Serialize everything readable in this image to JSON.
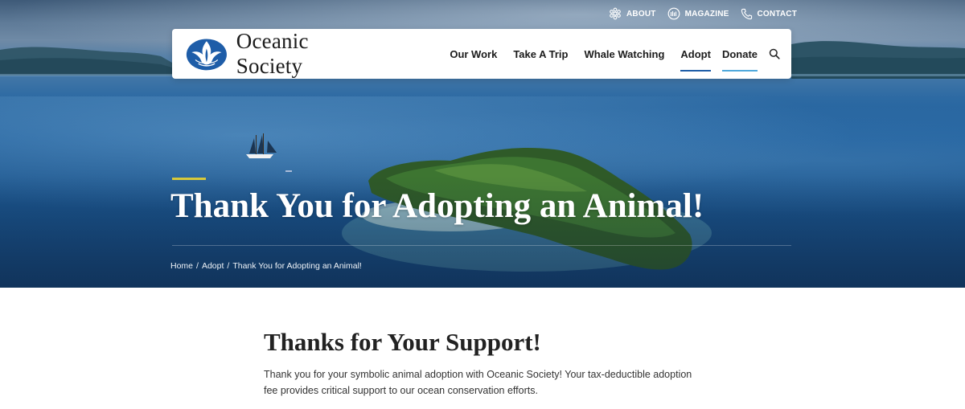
{
  "utility_nav": {
    "about": {
      "label": "ABOUT",
      "icon": "about-icon"
    },
    "magazine": {
      "label": "MAGAZINE",
      "icon": "magazine-icon"
    },
    "contact": {
      "label": "CONTACT",
      "icon": "phone-icon"
    }
  },
  "brand": {
    "name": "Oceanic Society",
    "logo_color": "#1e5da8"
  },
  "main_nav": {
    "items": [
      {
        "label": "Our Work"
      },
      {
        "label": "Take A Trip"
      },
      {
        "label": "Whale Watching"
      },
      {
        "label": "Adopt",
        "active": true
      },
      {
        "label": "Donate"
      }
    ],
    "search_icon": "search-icon"
  },
  "hero": {
    "title": "Thank You for Adopting an Animal!",
    "accent_color": "#d8c93a",
    "breadcrumb": {
      "home": "Home",
      "separator": "/",
      "adopt": "Adopt",
      "current": "Thank You for Adopting an Animal!"
    }
  },
  "content": {
    "heading": "Thanks for Your Support!",
    "body": "Thank you for your symbolic animal adoption with Oceanic Society! Your tax-deductible adoption fee provides critical support to our ocean conservation efforts."
  },
  "colors": {
    "nav_active_underline": "#1e5da8",
    "donate_underline": "#4fa9dc"
  }
}
